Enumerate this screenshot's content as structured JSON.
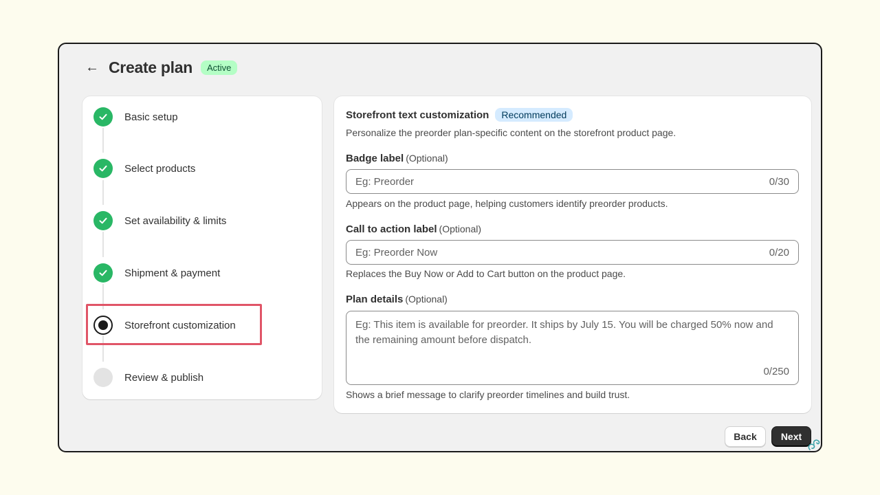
{
  "header": {
    "back_icon": "←",
    "title": "Create plan",
    "status_badge": "Active"
  },
  "steps": [
    {
      "label": "Basic setup",
      "state": "done"
    },
    {
      "label": "Select products",
      "state": "done"
    },
    {
      "label": "Set availability & limits",
      "state": "done"
    },
    {
      "label": "Shipment & payment",
      "state": "done"
    },
    {
      "label": "Storefront customization",
      "state": "current"
    },
    {
      "label": "Review & publish",
      "state": "pending"
    }
  ],
  "form": {
    "title": "Storefront text customization",
    "badge": "Recommended",
    "description": "Personalize the preorder plan-specific content on the storefront product page.",
    "fields": {
      "badge_label": {
        "label": "Badge label",
        "optional": "(Optional)",
        "placeholder": "Eg: Preorder",
        "counter": "0/30",
        "help": "Appears on the product page, helping customers identify preorder products."
      },
      "cta_label": {
        "label": "Call to action label",
        "optional": "(Optional)",
        "placeholder": "Eg: Preorder Now",
        "counter": "0/20",
        "help": "Replaces the Buy Now or Add to Cart button on the product page."
      },
      "plan_details": {
        "label": "Plan details",
        "optional": "(Optional)",
        "placeholder": "Eg: This item is available for preorder. It ships by July 15. You will be charged 50% now and the remaining amount before dispatch.",
        "counter": "0/250",
        "help": "Shows a brief message to clarify preorder timelines and build trust."
      }
    }
  },
  "footer": {
    "back_label": "Back",
    "next_label": "Next"
  },
  "colors": {
    "page_bg": "#fdfcee",
    "done": "#29b765",
    "active_badge": "#b4fec5",
    "recommended_badge": "#d5ebff",
    "highlight": "#e05567",
    "primary_button": "#303030"
  }
}
